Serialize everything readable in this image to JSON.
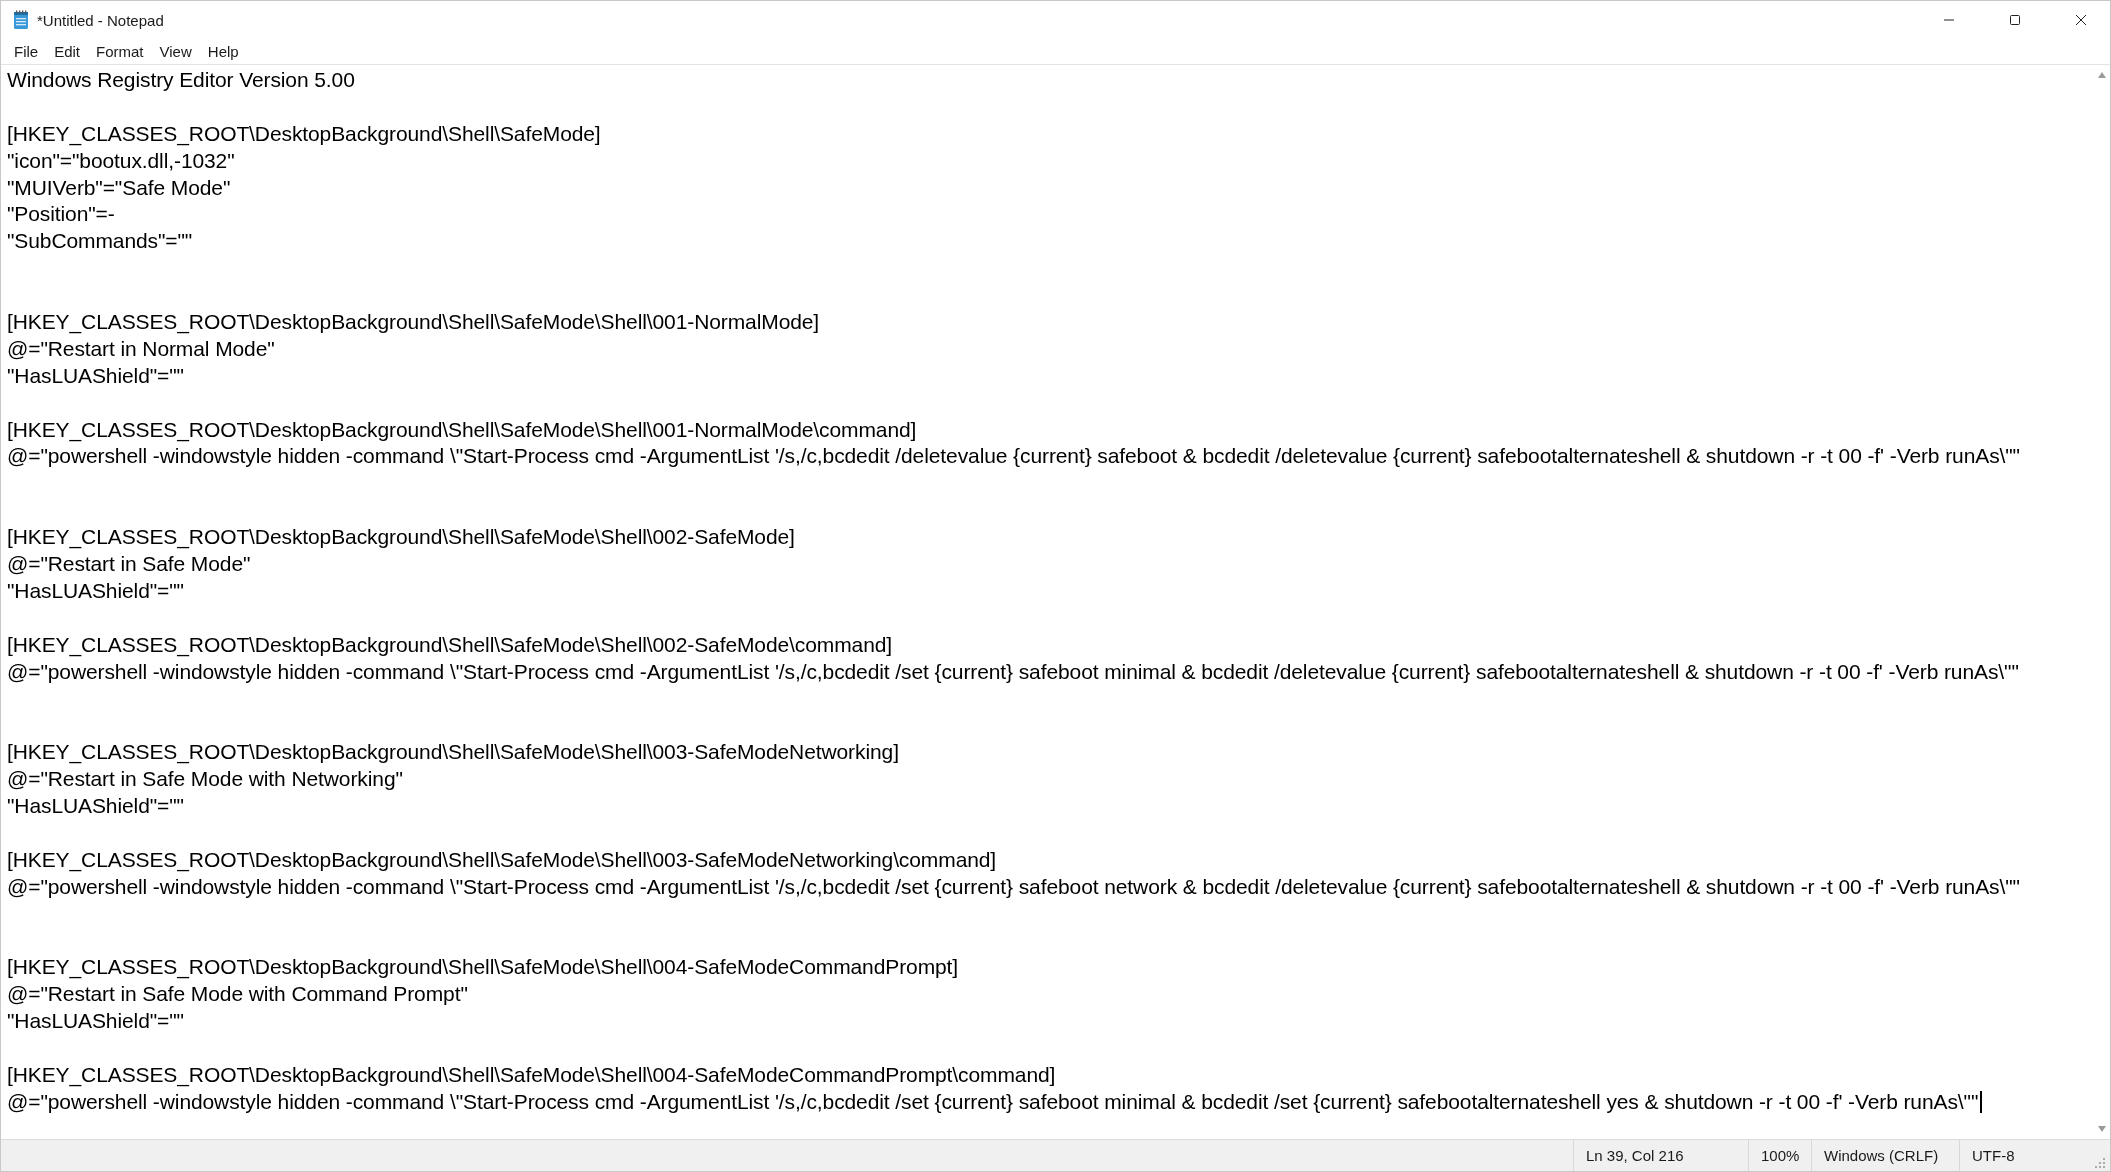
{
  "window": {
    "title": "*Untitled - Notepad"
  },
  "menu": [
    "File",
    "Edit",
    "Format",
    "View",
    "Help"
  ],
  "editor": {
    "lines": [
      {
        "kind": "text",
        "text": "Windows Registry Editor Version 5.00",
        "caret": false
      },
      {
        "kind": "blank"
      },
      {
        "kind": "text",
        "text": "[HKEY_CLASSES_ROOT\\DesktopBackground\\Shell\\SafeMode]",
        "caret": false
      },
      {
        "kind": "text",
        "text": "\"icon\"=\"bootux.dll,-1032\"",
        "caret": false
      },
      {
        "kind": "text",
        "text": "\"MUIVerb\"=\"Safe Mode\"",
        "caret": false
      },
      {
        "kind": "text",
        "text": "\"Position\"=-",
        "caret": false
      },
      {
        "kind": "text",
        "text": "\"SubCommands\"=\"\"",
        "caret": false
      },
      {
        "kind": "blank"
      },
      {
        "kind": "blank"
      },
      {
        "kind": "text",
        "text": "[HKEY_CLASSES_ROOT\\DesktopBackground\\Shell\\SafeMode\\Shell\\001-NormalMode]",
        "caret": false
      },
      {
        "kind": "text",
        "text": "@=\"Restart in Normal Mode\"",
        "caret": false
      },
      {
        "kind": "text",
        "text": "\"HasLUAShield\"=\"\"",
        "caret": false
      },
      {
        "kind": "blank"
      },
      {
        "kind": "text",
        "text": "[HKEY_CLASSES_ROOT\\DesktopBackground\\Shell\\SafeMode\\Shell\\001-NormalMode\\command]",
        "caret": false
      },
      {
        "kind": "text",
        "text": "@=\"powershell -windowstyle hidden -command \\\"Start-Process cmd -ArgumentList '/s,/c,bcdedit /deletevalue {current} safeboot & bcdedit /deletevalue {current} safebootalternateshell & shutdown -r -t 00 -f' -Verb runAs\\\"\"",
        "caret": false
      },
      {
        "kind": "blank"
      },
      {
        "kind": "blank"
      },
      {
        "kind": "text",
        "text": "[HKEY_CLASSES_ROOT\\DesktopBackground\\Shell\\SafeMode\\Shell\\002-SafeMode]",
        "caret": false
      },
      {
        "kind": "text",
        "text": "@=\"Restart in Safe Mode\"",
        "caret": false
      },
      {
        "kind": "text",
        "text": "\"HasLUAShield\"=\"\"",
        "caret": false
      },
      {
        "kind": "blank"
      },
      {
        "kind": "text",
        "text": "[HKEY_CLASSES_ROOT\\DesktopBackground\\Shell\\SafeMode\\Shell\\002-SafeMode\\command]",
        "caret": false
      },
      {
        "kind": "text",
        "text": "@=\"powershell -windowstyle hidden -command \\\"Start-Process cmd -ArgumentList '/s,/c,bcdedit /set {current} safeboot minimal & bcdedit /deletevalue {current} safebootalternateshell & shutdown -r -t 00 -f' -Verb runAs\\\"\"",
        "caret": false
      },
      {
        "kind": "blank"
      },
      {
        "kind": "blank"
      },
      {
        "kind": "text",
        "text": "[HKEY_CLASSES_ROOT\\DesktopBackground\\Shell\\SafeMode\\Shell\\003-SafeModeNetworking]",
        "caret": false
      },
      {
        "kind": "text",
        "text": "@=\"Restart in Safe Mode with Networking\"",
        "caret": false
      },
      {
        "kind": "text",
        "text": "\"HasLUAShield\"=\"\"",
        "caret": false
      },
      {
        "kind": "blank"
      },
      {
        "kind": "text",
        "text": "[HKEY_CLASSES_ROOT\\DesktopBackground\\Shell\\SafeMode\\Shell\\003-SafeModeNetworking\\command]",
        "caret": false
      },
      {
        "kind": "text",
        "text": "@=\"powershell -windowstyle hidden -command \\\"Start-Process cmd -ArgumentList '/s,/c,bcdedit /set {current} safeboot network & bcdedit /deletevalue {current} safebootalternateshell & shutdown -r -t 00 -f' -Verb runAs\\\"\"",
        "caret": false
      },
      {
        "kind": "blank"
      },
      {
        "kind": "blank"
      },
      {
        "kind": "text",
        "text": "[HKEY_CLASSES_ROOT\\DesktopBackground\\Shell\\SafeMode\\Shell\\004-SafeModeCommandPrompt]",
        "caret": false
      },
      {
        "kind": "text",
        "text": "@=\"Restart in Safe Mode with Command Prompt\"",
        "caret": false
      },
      {
        "kind": "text",
        "text": "\"HasLUAShield\"=\"\"",
        "caret": false
      },
      {
        "kind": "blank"
      },
      {
        "kind": "text",
        "text": "[HKEY_CLASSES_ROOT\\DesktopBackground\\Shell\\SafeMode\\Shell\\004-SafeModeCommandPrompt\\command]",
        "caret": false
      },
      {
        "kind": "text",
        "text": "@=\"powershell -windowstyle hidden -command \\\"Start-Process cmd -ArgumentList '/s,/c,bcdedit /set {current} safeboot minimal & bcdedit /set {current} safebootalternateshell yes & shutdown -r -t 00 -f' -Verb runAs\\\"\"",
        "caret": true
      }
    ]
  },
  "status_bar": {
    "position": "Ln 39, Col 216",
    "zoom": "100%",
    "line_ending": "Windows (CRLF)",
    "encoding": "UTF-8"
  }
}
